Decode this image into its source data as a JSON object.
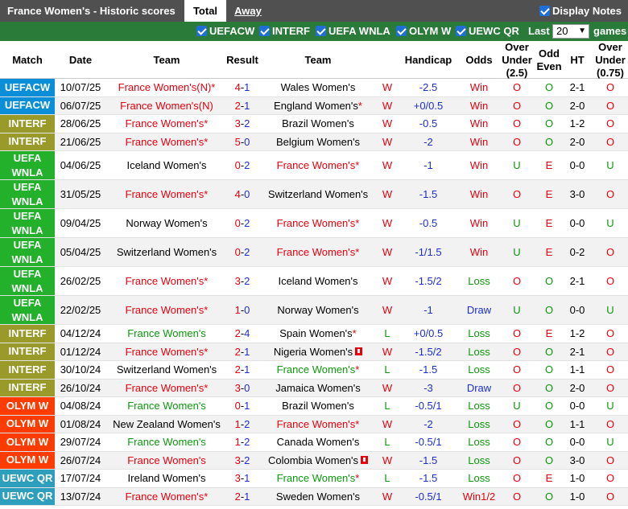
{
  "header": {
    "title": "France Women's - Historic scores",
    "tab_total": "Total",
    "tab_away": "Away",
    "display_notes": "Display Notes"
  },
  "filters": {
    "items": [
      "UEFACW",
      "INTERF",
      "UEFA WNLA",
      "OLYM W",
      "UEWC QR"
    ],
    "last_label": "Last",
    "last_value": "20",
    "games_label": "games"
  },
  "columns": {
    "match": "Match",
    "date": "Date",
    "team_home": "Team",
    "result": "Result",
    "team_away": "Team",
    "handicap": "Handicap",
    "odds": "Odds",
    "over_under": "Over Under (2.5)",
    "odd_even": "Odd Even",
    "ht": "HT",
    "over_under_ht": "Over Under (0.75)"
  },
  "colors": {
    "UEFACW": "#0a8ed8",
    "INTERF": "#9a9a2a",
    "UEFA WNLA": "#23b02a",
    "OLYM W": "#ff3c00",
    "UEWC QR": "#2e9ebd",
    "win_red": "#e8000d",
    "loss_green": "#0a9a0a",
    "draw_blue": "#1a2fd0"
  },
  "rows": [
    {
      "league": "UEFACW",
      "date": "10/07/25",
      "home": "France Women's(N)",
      "home_star": true,
      "home_color": "red",
      "away": "Wales Women's",
      "away_star": false,
      "away_color": "black",
      "score_h": "4",
      "score_a": "1",
      "wl": "W",
      "hcap": "-2.5",
      "odds": "Win",
      "ou": "O",
      "oe": "O",
      "ht": "2-1",
      "ou2": "O"
    },
    {
      "league": "UEFACW",
      "date": "06/07/25",
      "home": "France Women's(N)",
      "home_star": false,
      "home_color": "red",
      "away": "England Women's",
      "away_star": true,
      "away_color": "black",
      "score_h": "2",
      "score_a": "1",
      "wl": "W",
      "hcap": "+0/0.5",
      "odds": "Win",
      "ou": "O",
      "oe": "O",
      "ht": "2-0",
      "ou2": "O"
    },
    {
      "league": "INTERF",
      "date": "28/06/25",
      "home": "France Women's",
      "home_star": true,
      "home_color": "red",
      "away": "Brazil Women's",
      "away_star": false,
      "away_color": "black",
      "score_h": "3",
      "score_a": "2",
      "wl": "W",
      "hcap": "-0.5",
      "odds": "Win",
      "ou": "O",
      "oe": "O",
      "ht": "1-2",
      "ou2": "O"
    },
    {
      "league": "INTERF",
      "date": "21/06/25",
      "home": "France Women's",
      "home_star": true,
      "home_color": "red",
      "away": "Belgium Women's",
      "away_star": false,
      "away_color": "black",
      "score_h": "5",
      "score_a": "0",
      "wl": "W",
      "hcap": "-2",
      "odds": "Win",
      "ou": "O",
      "oe": "O",
      "ht": "2-0",
      "ou2": "O"
    },
    {
      "league": "UEFA WNLA",
      "date": "04/06/25",
      "home": "Iceland Women's",
      "home_star": false,
      "home_color": "black",
      "away": "France Women's",
      "away_star": true,
      "away_color": "red",
      "score_h": "0",
      "score_a": "2",
      "wl": "W",
      "hcap": "-1",
      "odds": "Win",
      "ou": "U",
      "oe": "E",
      "ht": "0-0",
      "ou2": "U"
    },
    {
      "league": "UEFA WNLA",
      "date": "31/05/25",
      "home": "France Women's",
      "home_star": true,
      "home_color": "red",
      "away": "Switzerland Women's",
      "away_star": false,
      "away_color": "black",
      "score_h": "4",
      "score_a": "0",
      "wl": "W",
      "hcap": "-1.5",
      "odds": "Win",
      "ou": "O",
      "oe": "E",
      "ht": "3-0",
      "ou2": "O"
    },
    {
      "league": "UEFA WNLA",
      "date": "09/04/25",
      "home": "Norway Women's",
      "home_star": false,
      "home_color": "black",
      "away": "France Women's",
      "away_star": true,
      "away_color": "red",
      "score_h": "0",
      "score_a": "2",
      "wl": "W",
      "hcap": "-0.5",
      "odds": "Win",
      "ou": "U",
      "oe": "E",
      "ht": "0-0",
      "ou2": "U"
    },
    {
      "league": "UEFA WNLA",
      "date": "05/04/25",
      "home": "Switzerland Women's",
      "home_star": false,
      "home_color": "black",
      "away": "France Women's",
      "away_star": true,
      "away_color": "red",
      "score_h": "0",
      "score_a": "2",
      "wl": "W",
      "hcap": "-1/1.5",
      "odds": "Win",
      "ou": "U",
      "oe": "E",
      "ht": "0-2",
      "ou2": "O"
    },
    {
      "league": "UEFA WNLA",
      "date": "26/02/25",
      "home": "France Women's",
      "home_star": true,
      "home_color": "red",
      "away": "Iceland Women's",
      "away_star": false,
      "away_color": "black",
      "score_h": "3",
      "score_a": "2",
      "wl": "W",
      "hcap": "-1.5/2",
      "odds": "Loss",
      "ou": "O",
      "oe": "O",
      "ht": "2-1",
      "ou2": "O"
    },
    {
      "league": "UEFA WNLA",
      "date": "22/02/25",
      "home": "France Women's",
      "home_star": true,
      "home_color": "red",
      "away": "Norway Women's",
      "away_star": false,
      "away_color": "black",
      "score_h": "1",
      "score_a": "0",
      "wl": "W",
      "hcap": "-1",
      "odds": "Draw",
      "ou": "U",
      "oe": "O",
      "ht": "0-0",
      "ou2": "U"
    },
    {
      "league": "INTERF",
      "date": "04/12/24",
      "home": "France Women's",
      "home_star": false,
      "home_color": "green",
      "away": "Spain Women's",
      "away_star": true,
      "away_color": "black",
      "score_h": "2",
      "score_a": "4",
      "wl": "L",
      "hcap": "+0/0.5",
      "odds": "Loss",
      "ou": "O",
      "oe": "E",
      "ht": "1-2",
      "ou2": "O"
    },
    {
      "league": "INTERF",
      "date": "01/12/24",
      "home": "France Women's",
      "home_star": true,
      "home_color": "red",
      "away": "Nigeria Women's",
      "away_star": false,
      "away_flag": true,
      "away_color": "black",
      "score_h": "2",
      "score_a": "1",
      "wl": "W",
      "hcap": "-1.5/2",
      "odds": "Loss",
      "ou": "O",
      "oe": "O",
      "ht": "2-1",
      "ou2": "O"
    },
    {
      "league": "INTERF",
      "date": "30/10/24",
      "home": "Switzerland Women's",
      "home_star": false,
      "home_color": "black",
      "away": "France Women's",
      "away_star": true,
      "away_color": "green",
      "score_h": "2",
      "score_a": "1",
      "wl": "L",
      "hcap": "-1.5",
      "odds": "Loss",
      "ou": "O",
      "oe": "O",
      "ht": "1-1",
      "ou2": "O"
    },
    {
      "league": "INTERF",
      "date": "26/10/24",
      "home": "France Women's",
      "home_star": true,
      "home_color": "red",
      "away": "Jamaica Women's",
      "away_star": false,
      "away_color": "black",
      "score_h": "3",
      "score_a": "0",
      "wl": "W",
      "hcap": "-3",
      "odds": "Draw",
      "ou": "O",
      "oe": "O",
      "ht": "2-0",
      "ou2": "O"
    },
    {
      "league": "OLYM W",
      "date": "04/08/24",
      "home": "France Women's",
      "home_star": false,
      "home_color": "green",
      "away": "Brazil Women's",
      "away_star": false,
      "away_color": "black",
      "score_h": "0",
      "score_a": "1",
      "wl": "L",
      "hcap": "-0.5/1",
      "odds": "Loss",
      "ou": "U",
      "oe": "O",
      "ht": "0-0",
      "ou2": "U"
    },
    {
      "league": "OLYM W",
      "date": "01/08/24",
      "home": "New Zealand Women's",
      "home_star": false,
      "home_color": "black",
      "away": "France Women's",
      "away_star": true,
      "away_color": "red",
      "score_h": "1",
      "score_a": "2",
      "wl": "W",
      "hcap": "-2",
      "odds": "Loss",
      "ou": "O",
      "oe": "O",
      "ht": "1-1",
      "ou2": "O"
    },
    {
      "league": "OLYM W",
      "date": "29/07/24",
      "home": "France Women's",
      "home_star": false,
      "home_color": "green",
      "away": "Canada Women's",
      "away_star": false,
      "away_color": "black",
      "score_h": "1",
      "score_a": "2",
      "wl": "L",
      "hcap": "-0.5/1",
      "odds": "Loss",
      "ou": "O",
      "oe": "O",
      "ht": "0-0",
      "ou2": "U"
    },
    {
      "league": "OLYM W",
      "date": "26/07/24",
      "home": "France Women's",
      "home_star": false,
      "home_color": "red",
      "away": "Colombia Women's",
      "away_star": false,
      "away_flag": true,
      "away_color": "black",
      "score_h": "3",
      "score_a": "2",
      "wl": "W",
      "hcap": "-1.5",
      "odds": "Loss",
      "ou": "O",
      "oe": "O",
      "ht": "3-0",
      "ou2": "O"
    },
    {
      "league": "UEWC QR",
      "date": "17/07/24",
      "home": "Ireland Women's",
      "home_star": false,
      "home_color": "black",
      "away": "France Women's",
      "away_star": true,
      "away_color": "green",
      "score_h": "3",
      "score_a": "1",
      "wl": "L",
      "hcap": "-1.5",
      "odds": "Loss",
      "ou": "O",
      "oe": "E",
      "ht": "1-0",
      "ou2": "O"
    },
    {
      "league": "UEWC QR",
      "date": "13/07/24",
      "home": "France Women's",
      "home_star": true,
      "home_color": "red",
      "away": "Sweden Women's",
      "away_star": false,
      "away_color": "black",
      "score_h": "2",
      "score_a": "1",
      "wl": "W",
      "hcap": "-0.5/1",
      "odds": "Win1/2",
      "ou": "O",
      "oe": "O",
      "ht": "1-0",
      "ou2": "O"
    }
  ]
}
